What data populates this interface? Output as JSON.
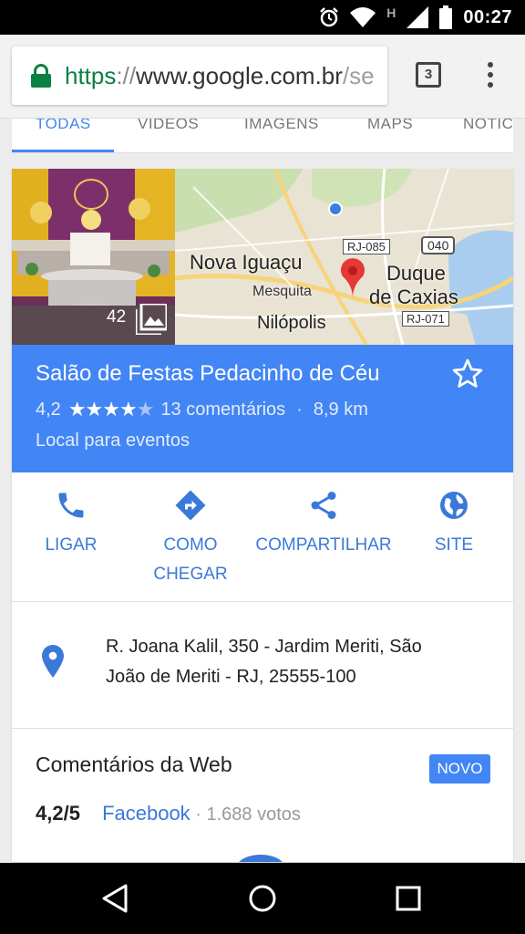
{
  "status_bar": {
    "time": "00:27",
    "network": "H"
  },
  "browser": {
    "url_scheme": "https",
    "url_sep": "://",
    "url_host": "www.google.com.br",
    "url_rest": "/se",
    "tab_count": "3"
  },
  "search_tabs": [
    {
      "label": "TODAS",
      "active": true
    },
    {
      "label": "VÍDEOS"
    },
    {
      "label": "IMAGENS"
    },
    {
      "label": "MAPS"
    },
    {
      "label": "NOTÍC"
    }
  ],
  "photo": {
    "count": "42"
  },
  "map_labels": {
    "nova_iguacu": "Nova Iguaçu",
    "mesquita": "Mesquita",
    "nilopolis": "Nilópolis",
    "duque": "Duque",
    "de_caxias": "de Caxias",
    "rj085": "RJ-085",
    "r040": "040",
    "rj071": "RJ-071"
  },
  "place": {
    "name": "Salão de Festas Pedacinho de Céu",
    "rating": "4,2",
    "stars_filled": 4,
    "reviews": "13 comentários",
    "distance": "8,9 km",
    "category": "Local para eventos"
  },
  "actions": {
    "call": "LIGAR",
    "directions_1": "COMO",
    "directions_2": "CHEGAR",
    "share": "COMPARTILHAR",
    "site": "SITE"
  },
  "address": {
    "line1": "R. Joana Kalil, 350 - Jardim Meriti, São",
    "line2": "João de Meriti - RJ, 25555-100"
  },
  "web_reviews": {
    "title": "Comentários da Web",
    "badge": "NOVO",
    "score": "4,2/5",
    "source": "Facebook",
    "votes": " · 1.688 votos"
  },
  "colors": {
    "accent": "#4285f4",
    "link": "#3b79d8",
    "lock": "#0b8043"
  }
}
